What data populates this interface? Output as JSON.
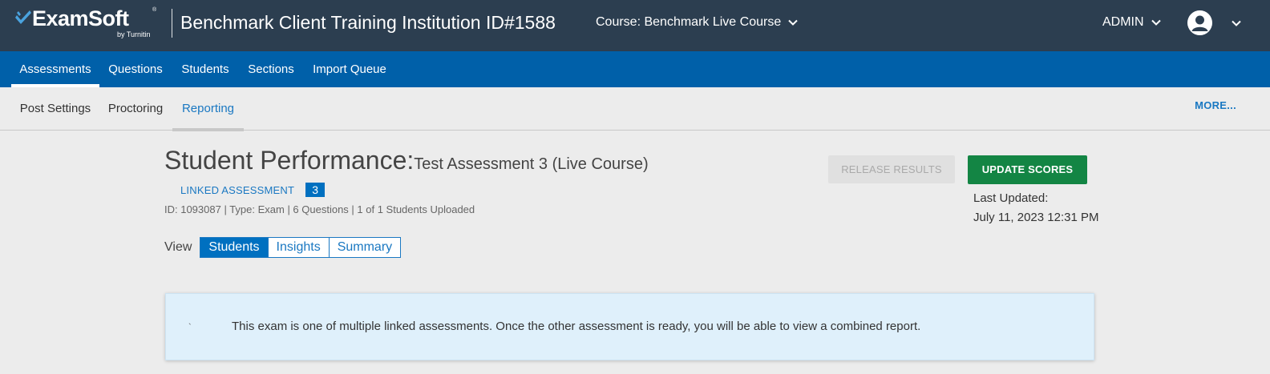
{
  "header": {
    "logo_text": "ExamSoft",
    "logo_sub": "by Turnitin",
    "logo_reg": "®",
    "institution_title": "Benchmark Client Training Institution ID#1588",
    "course_label": "Course: Benchmark Live Course",
    "user_label": "ADMIN",
    "colors": {
      "background": "#2c3e50",
      "logo_mark": "#4aa3df"
    }
  },
  "primary_nav": {
    "items": [
      {
        "label": "Assessments",
        "active": true
      },
      {
        "label": "Questions"
      },
      {
        "label": "Students"
      },
      {
        "label": "Sections"
      },
      {
        "label": "Import Queue"
      }
    ],
    "color": "#0060a9"
  },
  "secondary_nav": {
    "items": [
      {
        "label": "Post Settings"
      },
      {
        "label": "Proctoring"
      },
      {
        "label": "Reporting",
        "active": true
      }
    ],
    "more_label": "MORE..."
  },
  "report": {
    "title": "Student Performance:",
    "subtitle": "Test Assessment 3 (Live Course)",
    "linked_label": "LINKED ASSESSMENT",
    "linked_count": "3",
    "meta": "ID: 1093087 | Type: Exam | 6 Questions | 1 of 1 Students Uploaded",
    "view_label": "View",
    "view_options": [
      {
        "label": "Students",
        "active": true
      },
      {
        "label": "Insights"
      },
      {
        "label": "Summary"
      }
    ],
    "release_label": "RELEASE RESULTS",
    "update_label": "UPDATE SCORES",
    "last_updated_label": "Last Updated:",
    "last_updated_value": "July 11, 2023 12:31 PM"
  },
  "banner": {
    "icon": "info-icon",
    "glyph": "`",
    "text": "This exam is one of multiple linked assessments. Once the other assessment is ready, you will be able to view a combined report."
  }
}
